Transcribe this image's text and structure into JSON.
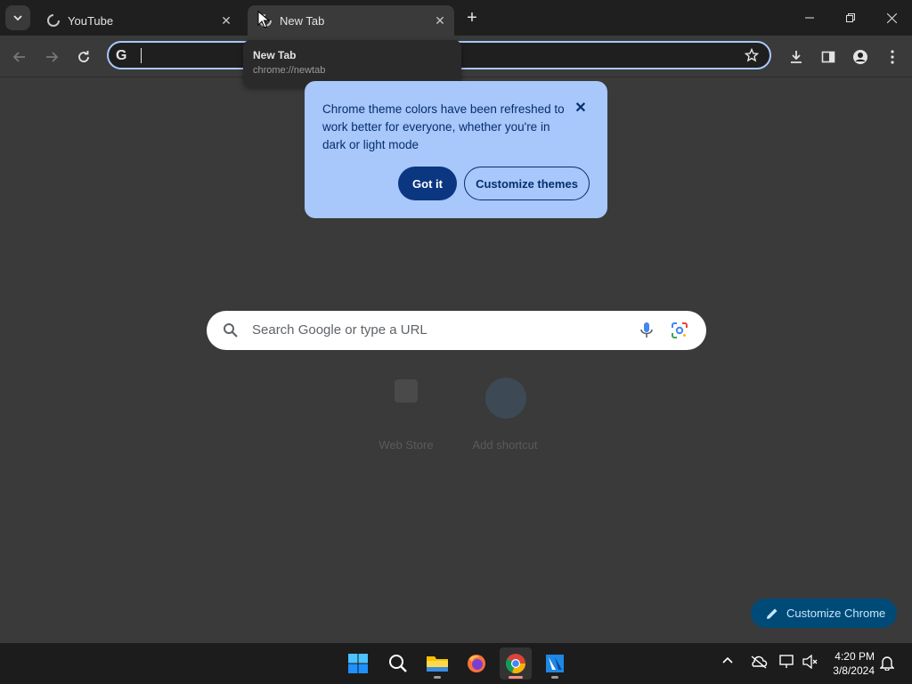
{
  "tabs": [
    {
      "title": "YouTube",
      "active": false
    },
    {
      "title": "New Tab",
      "active": true
    }
  ],
  "hover_card": {
    "title": "New Tab",
    "url": "chrome://newtab"
  },
  "promo": {
    "message": "Chrome theme colors have been refreshed to work better for everyone, whether you're in dark or light mode",
    "primary_button": "Got it",
    "secondary_button": "Customize themes"
  },
  "search": {
    "placeholder": "Search Google or type a URL"
  },
  "shortcuts": [
    {
      "label": "Web Store"
    },
    {
      "label": "Add shortcut"
    }
  ],
  "customize_chrome": {
    "label": "Customize Chrome"
  },
  "clock": {
    "time": "4:20 PM",
    "date": "3/8/2024"
  },
  "colors": {
    "accent": "#a8c7fa",
    "bubble_text": "#062e6f",
    "primary_button": "#0b3680",
    "customize_chip": "#004a77"
  }
}
